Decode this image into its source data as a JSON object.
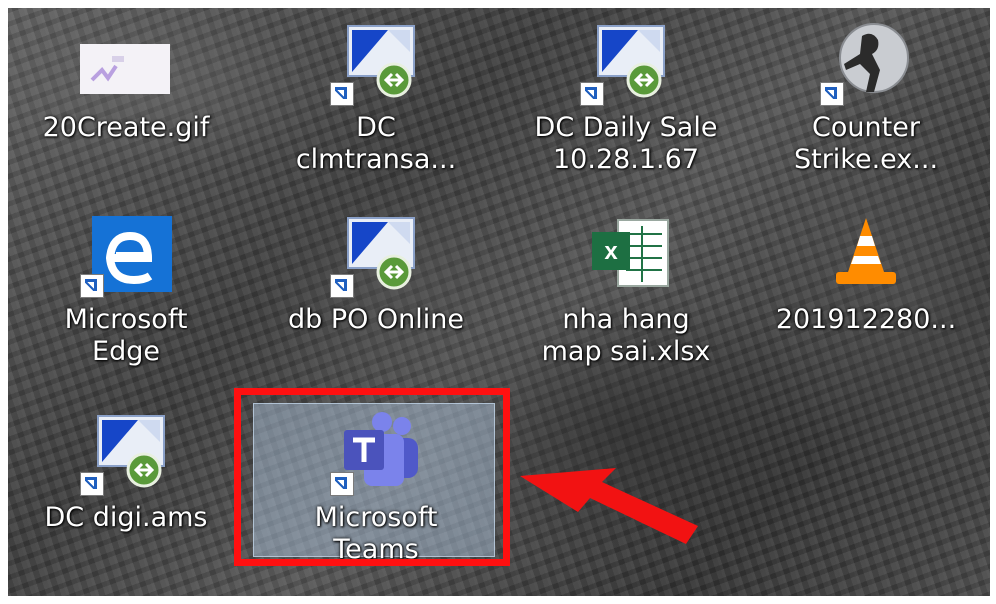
{
  "desktop": {
    "icons": [
      {
        "label": "20Create.gif",
        "icon": "gif-image-icon"
      },
      {
        "label": "DC\nclmtransa...",
        "icon": "remote-desktop-icon"
      },
      {
        "label": "DC Daily Sale\n10.28.1.67",
        "icon": "remote-desktop-icon"
      },
      {
        "label": "Counter\nStrike.ex...",
        "icon": "counter-strike-icon"
      },
      {
        "label": "Microsoft\nEdge",
        "icon": "edge-icon"
      },
      {
        "label": "db PO Online",
        "icon": "remote-desktop-icon"
      },
      {
        "label": "nha hang\nmap sai.xlsx",
        "icon": "excel-icon"
      },
      {
        "label": "201912280...",
        "icon": "vlc-icon"
      },
      {
        "label": "DC digi.ams",
        "icon": "remote-desktop-icon"
      },
      {
        "label": "Microsoft\nTeams",
        "icon": "teams-icon",
        "selected": true
      }
    ]
  },
  "annotation": {
    "color": "#ff1010",
    "target": "Microsoft Teams"
  }
}
